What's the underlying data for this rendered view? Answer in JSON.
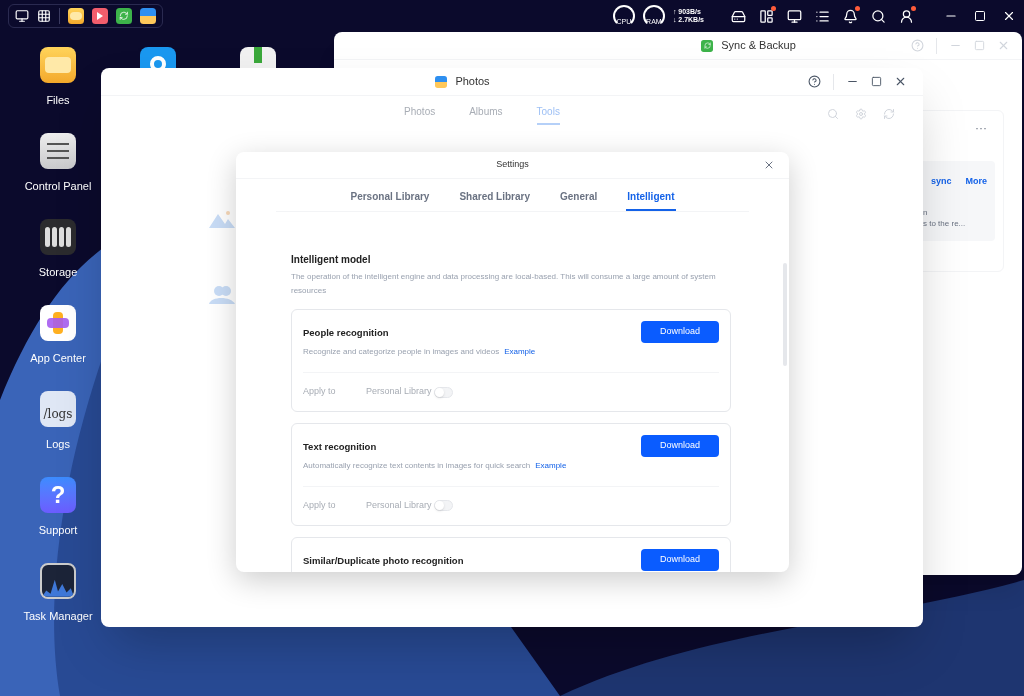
{
  "taskbar": {
    "launchers": [
      {
        "kind": "desktop"
      },
      {
        "kind": "apps"
      }
    ],
    "pinned_apps": [
      {
        "kind": "files"
      },
      {
        "kind": "video"
      },
      {
        "kind": "sync"
      },
      {
        "kind": "photos"
      }
    ],
    "gauges": [
      {
        "label": "CPU"
      },
      {
        "label": "RAM"
      }
    ],
    "upload": "↑ 903B/s",
    "download": "↓ 2.7KB/s",
    "tray": [
      {
        "kind": "backup",
        "badge": false
      },
      {
        "kind": "widgets",
        "badge": true
      },
      {
        "kind": "monitor",
        "badge": false
      },
      {
        "kind": "list",
        "badge": false
      },
      {
        "kind": "bell",
        "badge": true
      },
      {
        "kind": "search",
        "badge": false
      },
      {
        "kind": "user",
        "badge": true
      }
    ]
  },
  "desktop": {
    "icons": [
      {
        "kind": "files",
        "label": "Files"
      },
      {
        "kind": "control",
        "label": "Control Panel"
      },
      {
        "kind": "storage",
        "label": "Storage"
      },
      {
        "kind": "appcenter",
        "label": "App Center"
      },
      {
        "kind": "logs",
        "label": "Logs"
      },
      {
        "kind": "support",
        "label": "Support"
      },
      {
        "kind": "taskmanager",
        "label": "Task Manager"
      }
    ],
    "logs_icon_text": "/logs",
    "support_icon_text": "?"
  },
  "sync_window": {
    "title": "Sync & Backup",
    "menu_glyph": "···",
    "links": [
      "sync",
      "More"
    ],
    "fragments": [
      "n",
      "s to the re..."
    ]
  },
  "photos_window": {
    "title": "Photos",
    "tabs": [
      {
        "label": "Photos",
        "selected": false
      },
      {
        "label": "Albums",
        "selected": false
      },
      {
        "label": "Tools",
        "selected": true
      }
    ]
  },
  "settings": {
    "title": "Settings",
    "tabs": [
      {
        "label": "Personal Library",
        "selected": false
      },
      {
        "label": "Shared Library",
        "selected": false
      },
      {
        "label": "General",
        "selected": false
      },
      {
        "label": "Intelligent",
        "selected": true
      }
    ],
    "section_title": "Intelligent model",
    "section_description": "The operation of the intelligent engine and data processing are local-based. This will consume a large amount of system resources",
    "features": [
      {
        "title": "People recognition",
        "description": "Recognize and categorize people in images and videos",
        "link": "Example",
        "button": "Download",
        "apply_label": "Apply to",
        "library": "Personal Library",
        "enabled": false
      },
      {
        "title": "Text recognition",
        "description": "Automatically recognize text contents in images for quick search",
        "link": "Example",
        "button": "Download",
        "apply_label": "Apply to",
        "library": "Personal Library",
        "enabled": false
      },
      {
        "title": "Similar/Duplicate photo recognition",
        "button": "Download"
      }
    ]
  }
}
